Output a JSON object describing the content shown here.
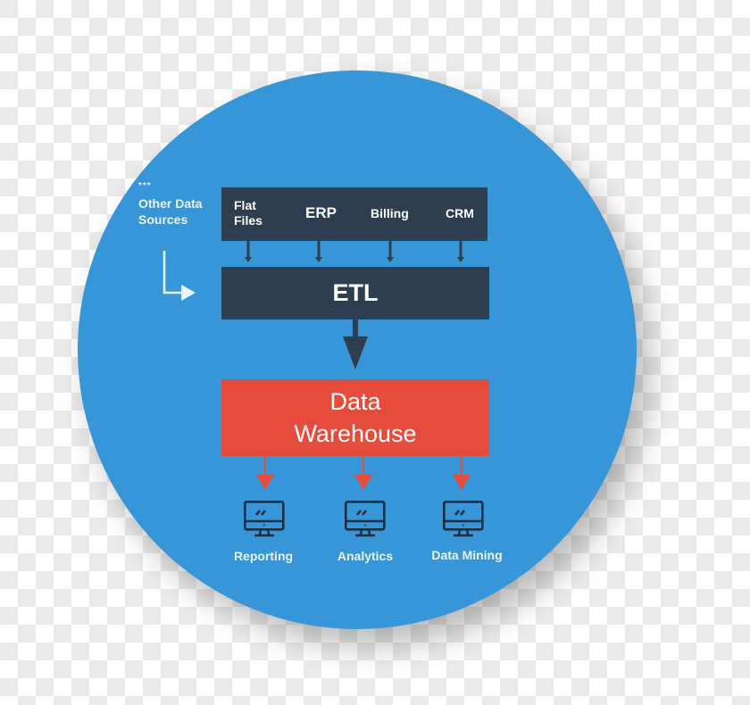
{
  "other_sources": {
    "stars": "***",
    "label_line1": "Other Data",
    "label_line2": "Sources"
  },
  "sources": [
    {
      "label_line1": "Flat",
      "label_line2": "Files"
    },
    {
      "label": "ERP"
    },
    {
      "label": "Billing"
    },
    {
      "label": "CRM"
    }
  ],
  "etl": {
    "label": "ETL"
  },
  "warehouse": {
    "label_line1": "Data",
    "label_line2": "Warehouse"
  },
  "outputs": [
    {
      "label": "Reporting",
      "icon": "monitor-icon"
    },
    {
      "label": "Analytics",
      "icon": "monitor-icon"
    },
    {
      "label": "Data Mining",
      "icon": "monitor-icon"
    }
  ],
  "colors": {
    "circle": "#3696d7",
    "dark_box": "#2d3e50",
    "warehouse": "#e54c3c",
    "icon": "#1f2e40"
  }
}
